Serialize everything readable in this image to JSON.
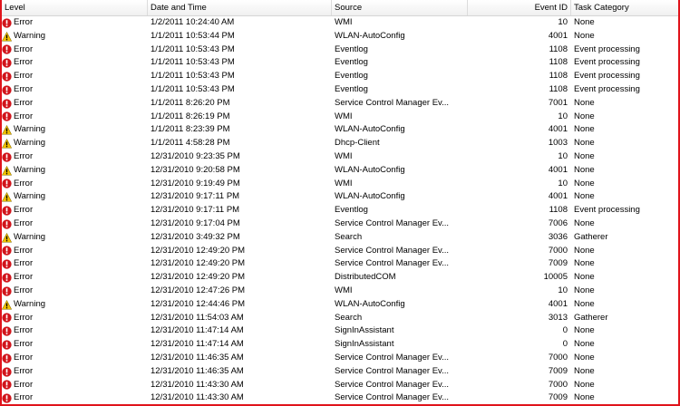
{
  "columns": {
    "level": "Level",
    "date": "Date and Time",
    "source": "Source",
    "event_id": "Event ID",
    "task": "Task Category"
  },
  "colors": {
    "error": "#d1141b",
    "warning": "#f2c200",
    "frame": "#e0141b"
  },
  "icons": {
    "Error": "error-icon",
    "Warning": "warning-icon"
  },
  "rows": [
    {
      "level": "Error",
      "date": "1/2/2011 10:24:40 AM",
      "source": "WMI",
      "event_id": "10",
      "task": "None"
    },
    {
      "level": "Warning",
      "date": "1/1/2011 10:53:44 PM",
      "source": "WLAN-AutoConfig",
      "event_id": "4001",
      "task": "None"
    },
    {
      "level": "Error",
      "date": "1/1/2011 10:53:43 PM",
      "source": "Eventlog",
      "event_id": "1108",
      "task": "Event processing"
    },
    {
      "level": "Error",
      "date": "1/1/2011 10:53:43 PM",
      "source": "Eventlog",
      "event_id": "1108",
      "task": "Event processing"
    },
    {
      "level": "Error",
      "date": "1/1/2011 10:53:43 PM",
      "source": "Eventlog",
      "event_id": "1108",
      "task": "Event processing"
    },
    {
      "level": "Error",
      "date": "1/1/2011 10:53:43 PM",
      "source": "Eventlog",
      "event_id": "1108",
      "task": "Event processing"
    },
    {
      "level": "Error",
      "date": "1/1/2011 8:26:20 PM",
      "source": "Service Control Manager Ev...",
      "event_id": "7001",
      "task": "None"
    },
    {
      "level": "Error",
      "date": "1/1/2011 8:26:19 PM",
      "source": "WMI",
      "event_id": "10",
      "task": "None"
    },
    {
      "level": "Warning",
      "date": "1/1/2011 8:23:39 PM",
      "source": "WLAN-AutoConfig",
      "event_id": "4001",
      "task": "None"
    },
    {
      "level": "Warning",
      "date": "1/1/2011 4:58:28 PM",
      "source": "Dhcp-Client",
      "event_id": "1003",
      "task": "None"
    },
    {
      "level": "Error",
      "date": "12/31/2010 9:23:35 PM",
      "source": "WMI",
      "event_id": "10",
      "task": "None"
    },
    {
      "level": "Warning",
      "date": "12/31/2010 9:20:58 PM",
      "source": "WLAN-AutoConfig",
      "event_id": "4001",
      "task": "None"
    },
    {
      "level": "Error",
      "date": "12/31/2010 9:19:49 PM",
      "source": "WMI",
      "event_id": "10",
      "task": "None"
    },
    {
      "level": "Warning",
      "date": "12/31/2010 9:17:11 PM",
      "source": "WLAN-AutoConfig",
      "event_id": "4001",
      "task": "None"
    },
    {
      "level": "Error",
      "date": "12/31/2010 9:17:11 PM",
      "source": "Eventlog",
      "event_id": "1108",
      "task": "Event processing"
    },
    {
      "level": "Error",
      "date": "12/31/2010 9:17:04 PM",
      "source": "Service Control Manager Ev...",
      "event_id": "7006",
      "task": "None"
    },
    {
      "level": "Warning",
      "date": "12/31/2010 3:49:32 PM",
      "source": "Search",
      "event_id": "3036",
      "task": "Gatherer"
    },
    {
      "level": "Error",
      "date": "12/31/2010 12:49:20 PM",
      "source": "Service Control Manager Ev...",
      "event_id": "7000",
      "task": "None"
    },
    {
      "level": "Error",
      "date": "12/31/2010 12:49:20 PM",
      "source": "Service Control Manager Ev...",
      "event_id": "7009",
      "task": "None"
    },
    {
      "level": "Error",
      "date": "12/31/2010 12:49:20 PM",
      "source": "DistributedCOM",
      "event_id": "10005",
      "task": "None"
    },
    {
      "level": "Error",
      "date": "12/31/2010 12:47:26 PM",
      "source": "WMI",
      "event_id": "10",
      "task": "None"
    },
    {
      "level": "Warning",
      "date": "12/31/2010 12:44:46 PM",
      "source": "WLAN-AutoConfig",
      "event_id": "4001",
      "task": "None"
    },
    {
      "level": "Error",
      "date": "12/31/2010 11:54:03 AM",
      "source": "Search",
      "event_id": "3013",
      "task": "Gatherer"
    },
    {
      "level": "Error",
      "date": "12/31/2010 11:47:14 AM",
      "source": "SignInAssistant",
      "event_id": "0",
      "task": "None"
    },
    {
      "level": "Error",
      "date": "12/31/2010 11:47:14 AM",
      "source": "SignInAssistant",
      "event_id": "0",
      "task": "None"
    },
    {
      "level": "Error",
      "date": "12/31/2010 11:46:35 AM",
      "source": "Service Control Manager Ev...",
      "event_id": "7000",
      "task": "None"
    },
    {
      "level": "Error",
      "date": "12/31/2010 11:46:35 AM",
      "source": "Service Control Manager Ev...",
      "event_id": "7009",
      "task": "None"
    },
    {
      "level": "Error",
      "date": "12/31/2010 11:43:30 AM",
      "source": "Service Control Manager Ev...",
      "event_id": "7000",
      "task": "None"
    },
    {
      "level": "Error",
      "date": "12/31/2010 11:43:30 AM",
      "source": "Service Control Manager Ev...",
      "event_id": "7009",
      "task": "None"
    }
  ]
}
